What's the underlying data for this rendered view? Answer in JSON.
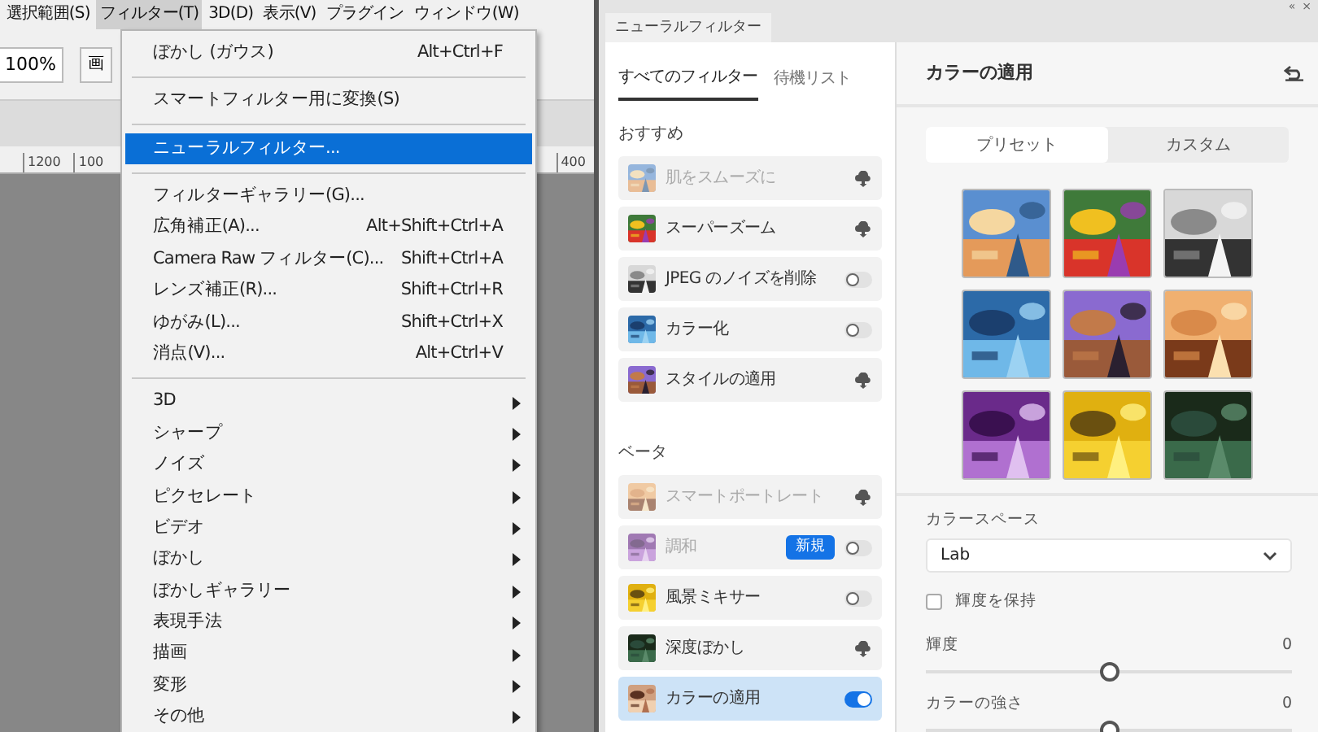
{
  "menubar": [
    {
      "label": "選択範囲(S)",
      "selected": false
    },
    {
      "label": "フィルター(T)",
      "selected": true
    },
    {
      "label": "3D(D)",
      "selected": false
    },
    {
      "label": "表示(V)",
      "selected": false
    },
    {
      "label": "プラグイン",
      "selected": false
    },
    {
      "label": "ウィンドウ(W)",
      "selected": false
    }
  ],
  "options_bar": {
    "zoom": "100%",
    "button": "画"
  },
  "ruler": [
    "1200",
    "100",
    "400"
  ],
  "filter_menu": [
    {
      "kind": "item",
      "label": "ぼかし (ガウス)",
      "shortcut": "Alt+Ctrl+F",
      "selected": false,
      "submenu": false
    },
    {
      "kind": "separator"
    },
    {
      "kind": "item",
      "label": "スマートフィルター用に変換(S)",
      "selected": false,
      "submenu": false
    },
    {
      "kind": "separator"
    },
    {
      "kind": "item",
      "label": "ニューラルフィルター...",
      "selected": true,
      "submenu": false
    },
    {
      "kind": "separator"
    },
    {
      "kind": "item",
      "label": "フィルターギャラリー(G)...",
      "selected": false,
      "submenu": false
    },
    {
      "kind": "item",
      "label": "広角補正(A)...",
      "shortcut": "Alt+Shift+Ctrl+A",
      "selected": false,
      "submenu": false
    },
    {
      "kind": "item",
      "label": "Camera Raw フィルター(C)...",
      "shortcut": "Shift+Ctrl+A",
      "selected": false,
      "submenu": false
    },
    {
      "kind": "item",
      "label": "レンズ補正(R)...",
      "shortcut": "Shift+Ctrl+R",
      "selected": false,
      "submenu": false
    },
    {
      "kind": "item",
      "label": "ゆがみ(L)...",
      "shortcut": "Shift+Ctrl+X",
      "selected": false,
      "submenu": false
    },
    {
      "kind": "item",
      "label": "消点(V)...",
      "shortcut": "Alt+Ctrl+V",
      "selected": false,
      "submenu": false
    },
    {
      "kind": "separator"
    },
    {
      "kind": "item",
      "label": "3D",
      "selected": false,
      "submenu": true
    },
    {
      "kind": "item",
      "label": "シャープ",
      "selected": false,
      "submenu": true
    },
    {
      "kind": "item",
      "label": "ノイズ",
      "selected": false,
      "submenu": true
    },
    {
      "kind": "item",
      "label": "ピクセレート",
      "selected": false,
      "submenu": true
    },
    {
      "kind": "item",
      "label": "ビデオ",
      "selected": false,
      "submenu": true
    },
    {
      "kind": "item",
      "label": "ぼかし",
      "selected": false,
      "submenu": true
    },
    {
      "kind": "item",
      "label": "ぼかしギャラリー",
      "selected": false,
      "submenu": true
    },
    {
      "kind": "item",
      "label": "表現手法",
      "selected": false,
      "submenu": true
    },
    {
      "kind": "item",
      "label": "描画",
      "selected": false,
      "submenu": true
    },
    {
      "kind": "item",
      "label": "変形",
      "selected": false,
      "submenu": true
    },
    {
      "kind": "item",
      "label": "その他",
      "selected": false,
      "submenu": true
    }
  ],
  "neural_panel": {
    "title": "ニューラルフィルター",
    "tabs": [
      {
        "label": "すべてのフィルター",
        "selected": true
      },
      {
        "label": "待機リスト",
        "selected": false
      }
    ],
    "sections": [
      {
        "heading": "おすすめ",
        "filters": [
          {
            "label": "肌をスムーズに",
            "disabled": true,
            "kind": "download",
            "selected": false
          },
          {
            "label": "スーパーズーム",
            "disabled": false,
            "kind": "download",
            "selected": false
          },
          {
            "label": "JPEG のノイズを削除",
            "disabled": false,
            "kind": "toggle",
            "on": false,
            "selected": false
          },
          {
            "label": "カラー化",
            "disabled": false,
            "kind": "toggle",
            "on": false,
            "selected": false
          },
          {
            "label": "スタイルの適用",
            "disabled": false,
            "kind": "download",
            "selected": false
          }
        ]
      },
      {
        "heading": "ベータ",
        "filters": [
          {
            "label": "スマートポートレート",
            "disabled": true,
            "kind": "download",
            "selected": false
          },
          {
            "label": "調和",
            "disabled": true,
            "kind": "toggle",
            "on": false,
            "badge": "新規",
            "selected": false
          },
          {
            "label": "風景ミキサー",
            "disabled": false,
            "kind": "toggle",
            "on": false,
            "selected": false
          },
          {
            "label": "深度ぼかし",
            "disabled": false,
            "kind": "download",
            "selected": false
          },
          {
            "label": "カラーの適用",
            "disabled": false,
            "kind": "toggle",
            "on": true,
            "selected": true
          }
        ]
      }
    ]
  },
  "settings": {
    "window_controls": [
      "«",
      "×"
    ],
    "title": "カラーの適用",
    "segments": [
      {
        "label": "プリセット",
        "selected": true
      },
      {
        "label": "カスタム",
        "selected": false
      }
    ],
    "presets": [
      {
        "kind": "picture"
      },
      {
        "kind": "picture"
      },
      {
        "kind": "picture"
      },
      {
        "kind": "picture"
      },
      {
        "kind": "picture"
      },
      {
        "kind": "picture"
      },
      {
        "kind": "picture"
      },
      {
        "kind": "picture"
      },
      {
        "kind": "picture"
      }
    ],
    "color_space": {
      "label": "カラースペース",
      "value": "Lab"
    },
    "preserve_luminance": {
      "label": "輝度を保持",
      "checked": false
    },
    "sliders": [
      {
        "label": "輝度",
        "reading": "0",
        "level": 0.5
      },
      {
        "label": "カラーの強さ",
        "reading": "0",
        "level": 0.5
      }
    ]
  }
}
